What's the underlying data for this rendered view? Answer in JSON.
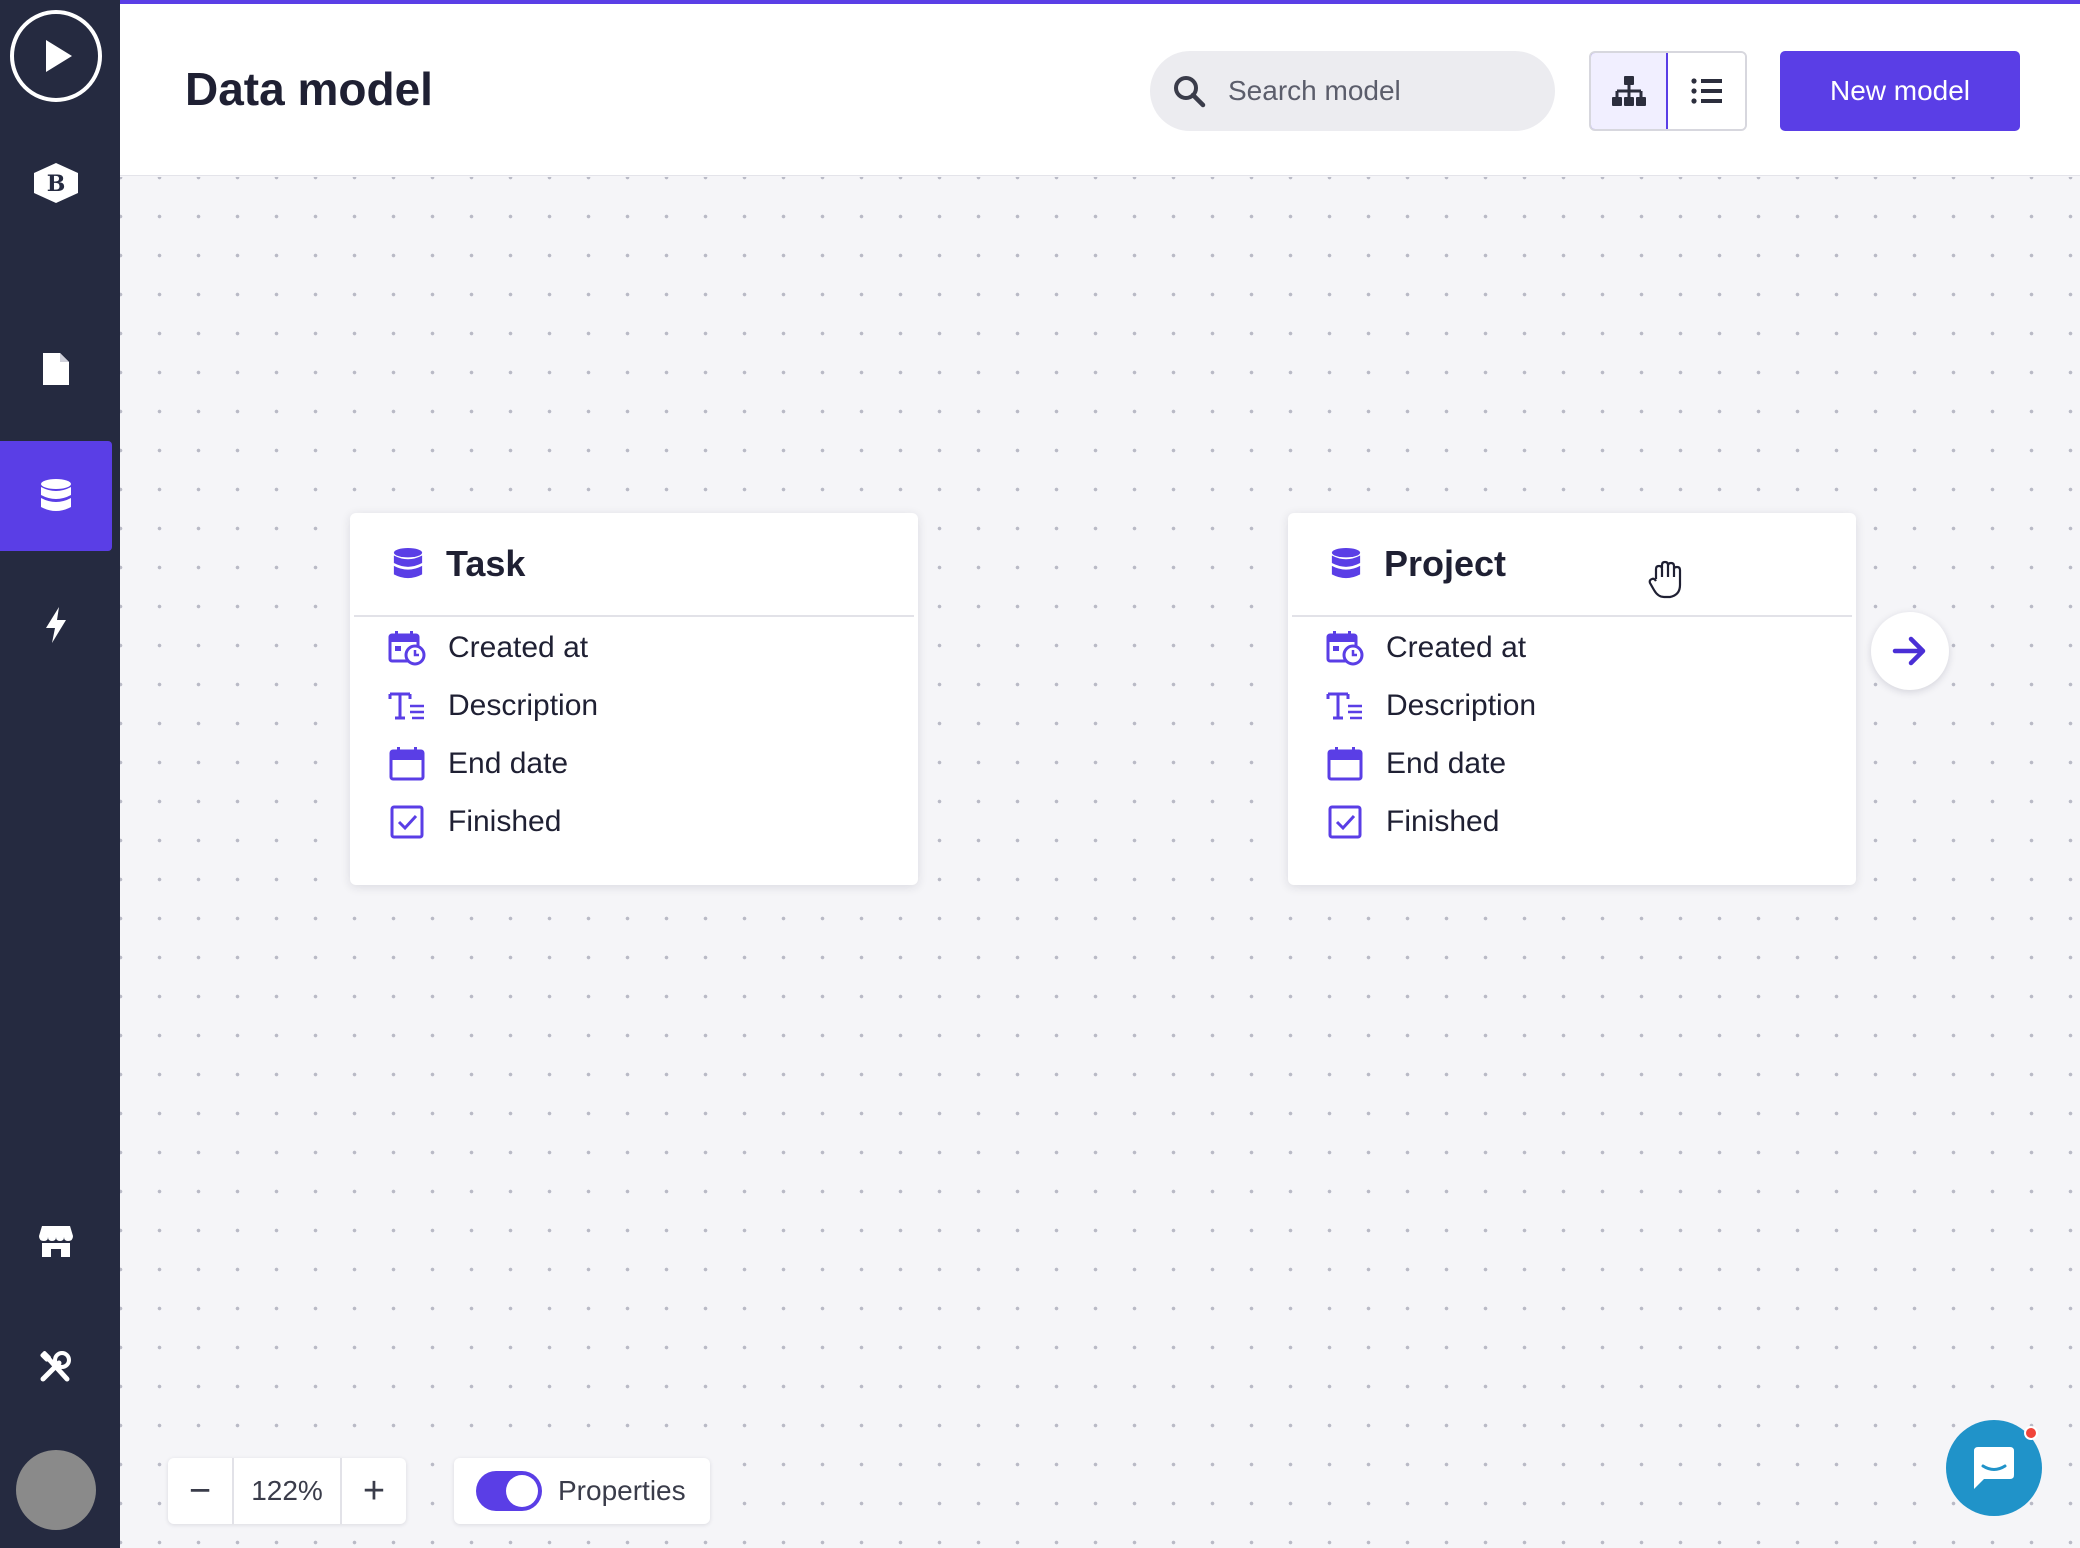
{
  "sidebar": {
    "items": [
      "play-logo",
      "brand-badge",
      "pages",
      "data-model",
      "actions",
      "store",
      "tools",
      "avatar"
    ],
    "brand_letter": "B"
  },
  "header": {
    "title": "Data model",
    "search": {
      "placeholder": "Search model"
    },
    "view_modes": [
      "diagram",
      "list"
    ],
    "active_view": "diagram",
    "new_button": "New model"
  },
  "models": [
    {
      "name": "Task",
      "properties": [
        {
          "icon": "datetime-icon",
          "label": "Created at"
        },
        {
          "icon": "text-icon",
          "label": "Description"
        },
        {
          "icon": "calendar-icon",
          "label": "End date"
        },
        {
          "icon": "checkbox-icon",
          "label": "Finished"
        }
      ]
    },
    {
      "name": "Project",
      "properties": [
        {
          "icon": "datetime-icon",
          "label": "Created at"
        },
        {
          "icon": "text-icon",
          "label": "Description"
        },
        {
          "icon": "calendar-icon",
          "label": "End date"
        },
        {
          "icon": "checkbox-icon",
          "label": "Finished"
        }
      ]
    }
  ],
  "zoom": {
    "value": "122%",
    "minus": "−",
    "plus": "+"
  },
  "properties_toggle": {
    "label": "Properties",
    "enabled": true
  },
  "colors": {
    "accent": "#5a3ee6",
    "sidebar": "#252a40",
    "chat": "#2093c9"
  }
}
